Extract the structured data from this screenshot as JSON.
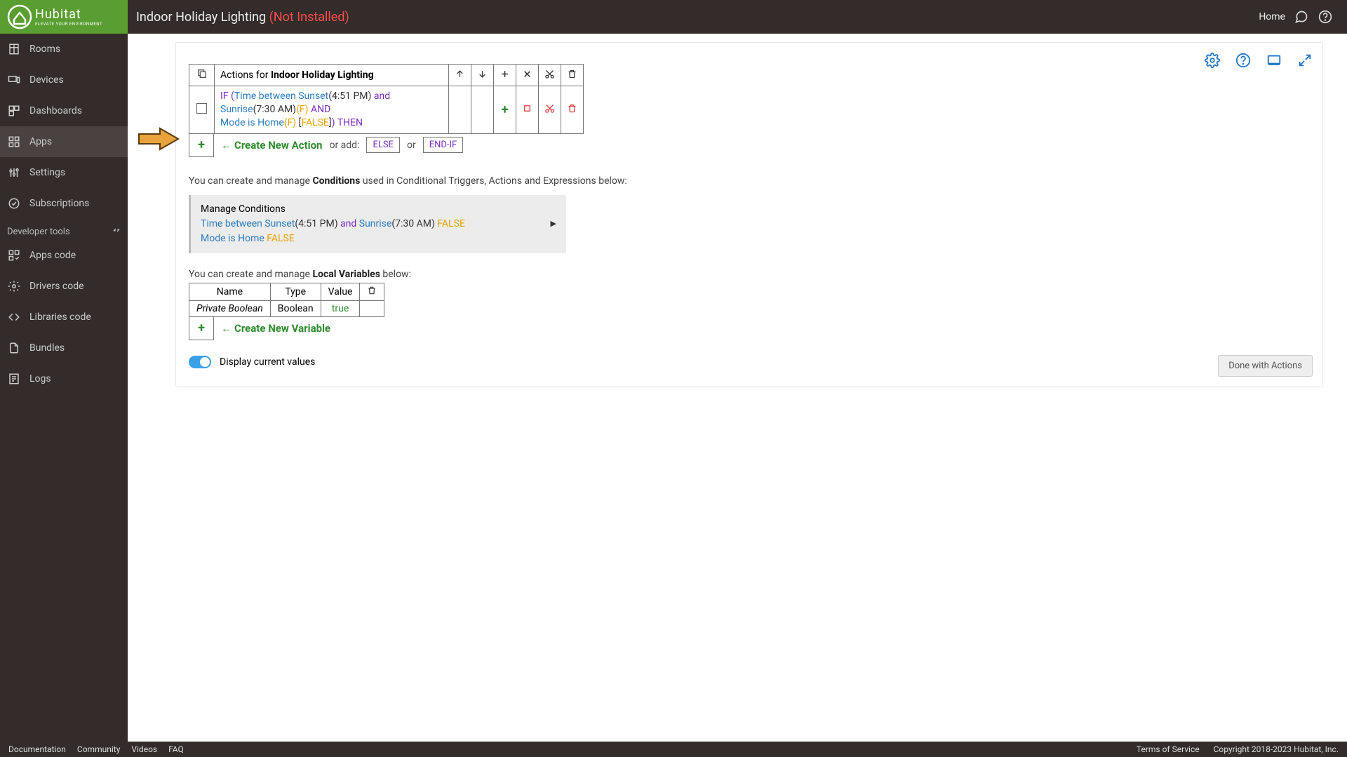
{
  "header": {
    "title": "Indoor Holiday Lighting",
    "status": "(Not Installed)",
    "home": "Home",
    "logo_name": "Hubitat",
    "logo_tag": "ELEVATE YOUR ENVIRONMENT"
  },
  "sidebar": {
    "items": [
      {
        "label": "Rooms",
        "icon": "rooms"
      },
      {
        "label": "Devices",
        "icon": "devices"
      },
      {
        "label": "Dashboards",
        "icon": "dashboards"
      },
      {
        "label": "Apps",
        "icon": "apps",
        "active": true
      },
      {
        "label": "Settings",
        "icon": "settings"
      },
      {
        "label": "Subscriptions",
        "icon": "subscriptions"
      }
    ],
    "dev_section": "Developer tools",
    "dev_items": [
      {
        "label": "Apps code",
        "icon": "apps-code"
      },
      {
        "label": "Drivers code",
        "icon": "drivers-code"
      },
      {
        "label": "Libraries code",
        "icon": "libraries-code"
      },
      {
        "label": "Bundles",
        "icon": "bundles"
      },
      {
        "label": "Logs",
        "icon": "logs"
      }
    ]
  },
  "actions": {
    "header_prefix": "Actions for ",
    "header_name": "Indoor Holiday Lighting",
    "rule": {
      "if": "IF",
      "open": "(",
      "tb": "Time between Sunset",
      "t1": "(4:51 PM)",
      "and1": " and ",
      "sr": "Sunrise",
      "t2": "(7:30 AM)",
      "f1": "(F)",
      "and_big": "  AND",
      "mode": "Mode is Home",
      "f2": "(F)",
      "bracket": " [",
      "false": "FALSE",
      "close": "]",
      "paren_close": ")",
      "then": " THEN"
    },
    "create_new": "Create New Action",
    "or_add": "or add:",
    "else": "ELSE",
    "or": "or",
    "endif": "END-IF"
  },
  "cond": {
    "intro1": "You can create and manage ",
    "intro_bold": "Conditions",
    "intro2": " used in Conditional Triggers, Actions and Expressions below:",
    "manage": "Manage Conditions",
    "l1_a": "Time between Sunset",
    "l1_t1": "(4:51 PM)",
    "l1_and": " and ",
    "l1_b": "Sunrise",
    "l1_t2": "(7:30 AM) ",
    "l1_f": "FALSE",
    "l2_a": "Mode is Home ",
    "l2_f": "FALSE"
  },
  "vars": {
    "intro1": "You can create and manage ",
    "intro_bold": "Local Variables",
    "intro2": " below:",
    "hdr_name": "Name",
    "hdr_type": "Type",
    "hdr_value": "Value",
    "row_name": "Private Boolean",
    "row_type": "Boolean",
    "row_value": "true",
    "create_new": "Create New Variable"
  },
  "toggle_label": "Display current values",
  "done": "Done with Actions",
  "footer": {
    "links": [
      "Documentation",
      "Community",
      "Videos",
      "FAQ"
    ],
    "tos": "Terms of Service",
    "copy": "Copyright 2018-2023 Hubitat, Inc."
  }
}
